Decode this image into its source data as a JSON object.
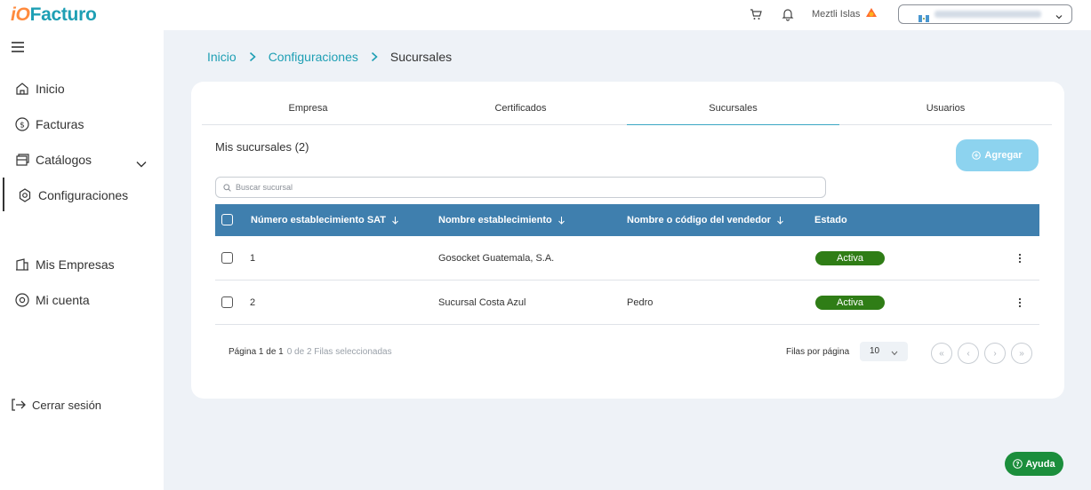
{
  "app": {
    "logo_prefix": "iO",
    "logo_text": "Facturo"
  },
  "header": {
    "user_name": "Meztli Islas",
    "cart_icon": "cart-icon",
    "bell_icon": "bell-icon"
  },
  "sidebar": {
    "items": [
      {
        "label": "Inicio",
        "icon": "home-icon"
      },
      {
        "label": "Facturas",
        "icon": "dollar-circle-icon"
      },
      {
        "label": "Catálogos",
        "icon": "catalog-icon"
      },
      {
        "label": "Configuraciones",
        "icon": "gear-icon"
      },
      {
        "label": "Mis Empresas",
        "icon": "building-icon"
      },
      {
        "label": "Mi cuenta",
        "icon": "at-sign-icon"
      }
    ],
    "logout_label": "Cerrar sesión"
  },
  "breadcrumb": {
    "items": [
      "Inicio",
      "Configuraciones",
      "Sucursales"
    ]
  },
  "tabs": [
    "Empresa",
    "Certificados",
    "Sucursales",
    "Usuarios"
  ],
  "active_tab": "Sucursales",
  "section": {
    "title": "Mis sucursales (2)",
    "add_label": "Agregar"
  },
  "search": {
    "placeholder": "Buscar sucursal",
    "value": ""
  },
  "table": {
    "columns": [
      "Número establecimiento SAT",
      "Nombre establecimiento",
      "Nombre o código del vendedor",
      "Estado"
    ],
    "rows": [
      {
        "number": "1",
        "name": "Gosocket Guatemala, S.A.",
        "seller": "",
        "status": "Activa"
      },
      {
        "number": "2",
        "name": "Sucursal Costa Azul",
        "seller": "Pedro",
        "status": "Activa"
      }
    ]
  },
  "pagination": {
    "page_text": "Página 1 de 1",
    "selected_text": "0 de 2 Filas seleccionadas",
    "rows_per_page_label": "Filas por página",
    "rows_per_page_value": "10",
    "first": "«",
    "prev": "‹",
    "next": "›",
    "last": "»"
  },
  "help": {
    "label": "Ayuda"
  },
  "colors": {
    "brand": "#1e9fb4",
    "table_header": "#3f7fae",
    "status_active": "#2f7d16",
    "add_button": "#8dd3ef",
    "help_button": "#1b8e3c"
  }
}
